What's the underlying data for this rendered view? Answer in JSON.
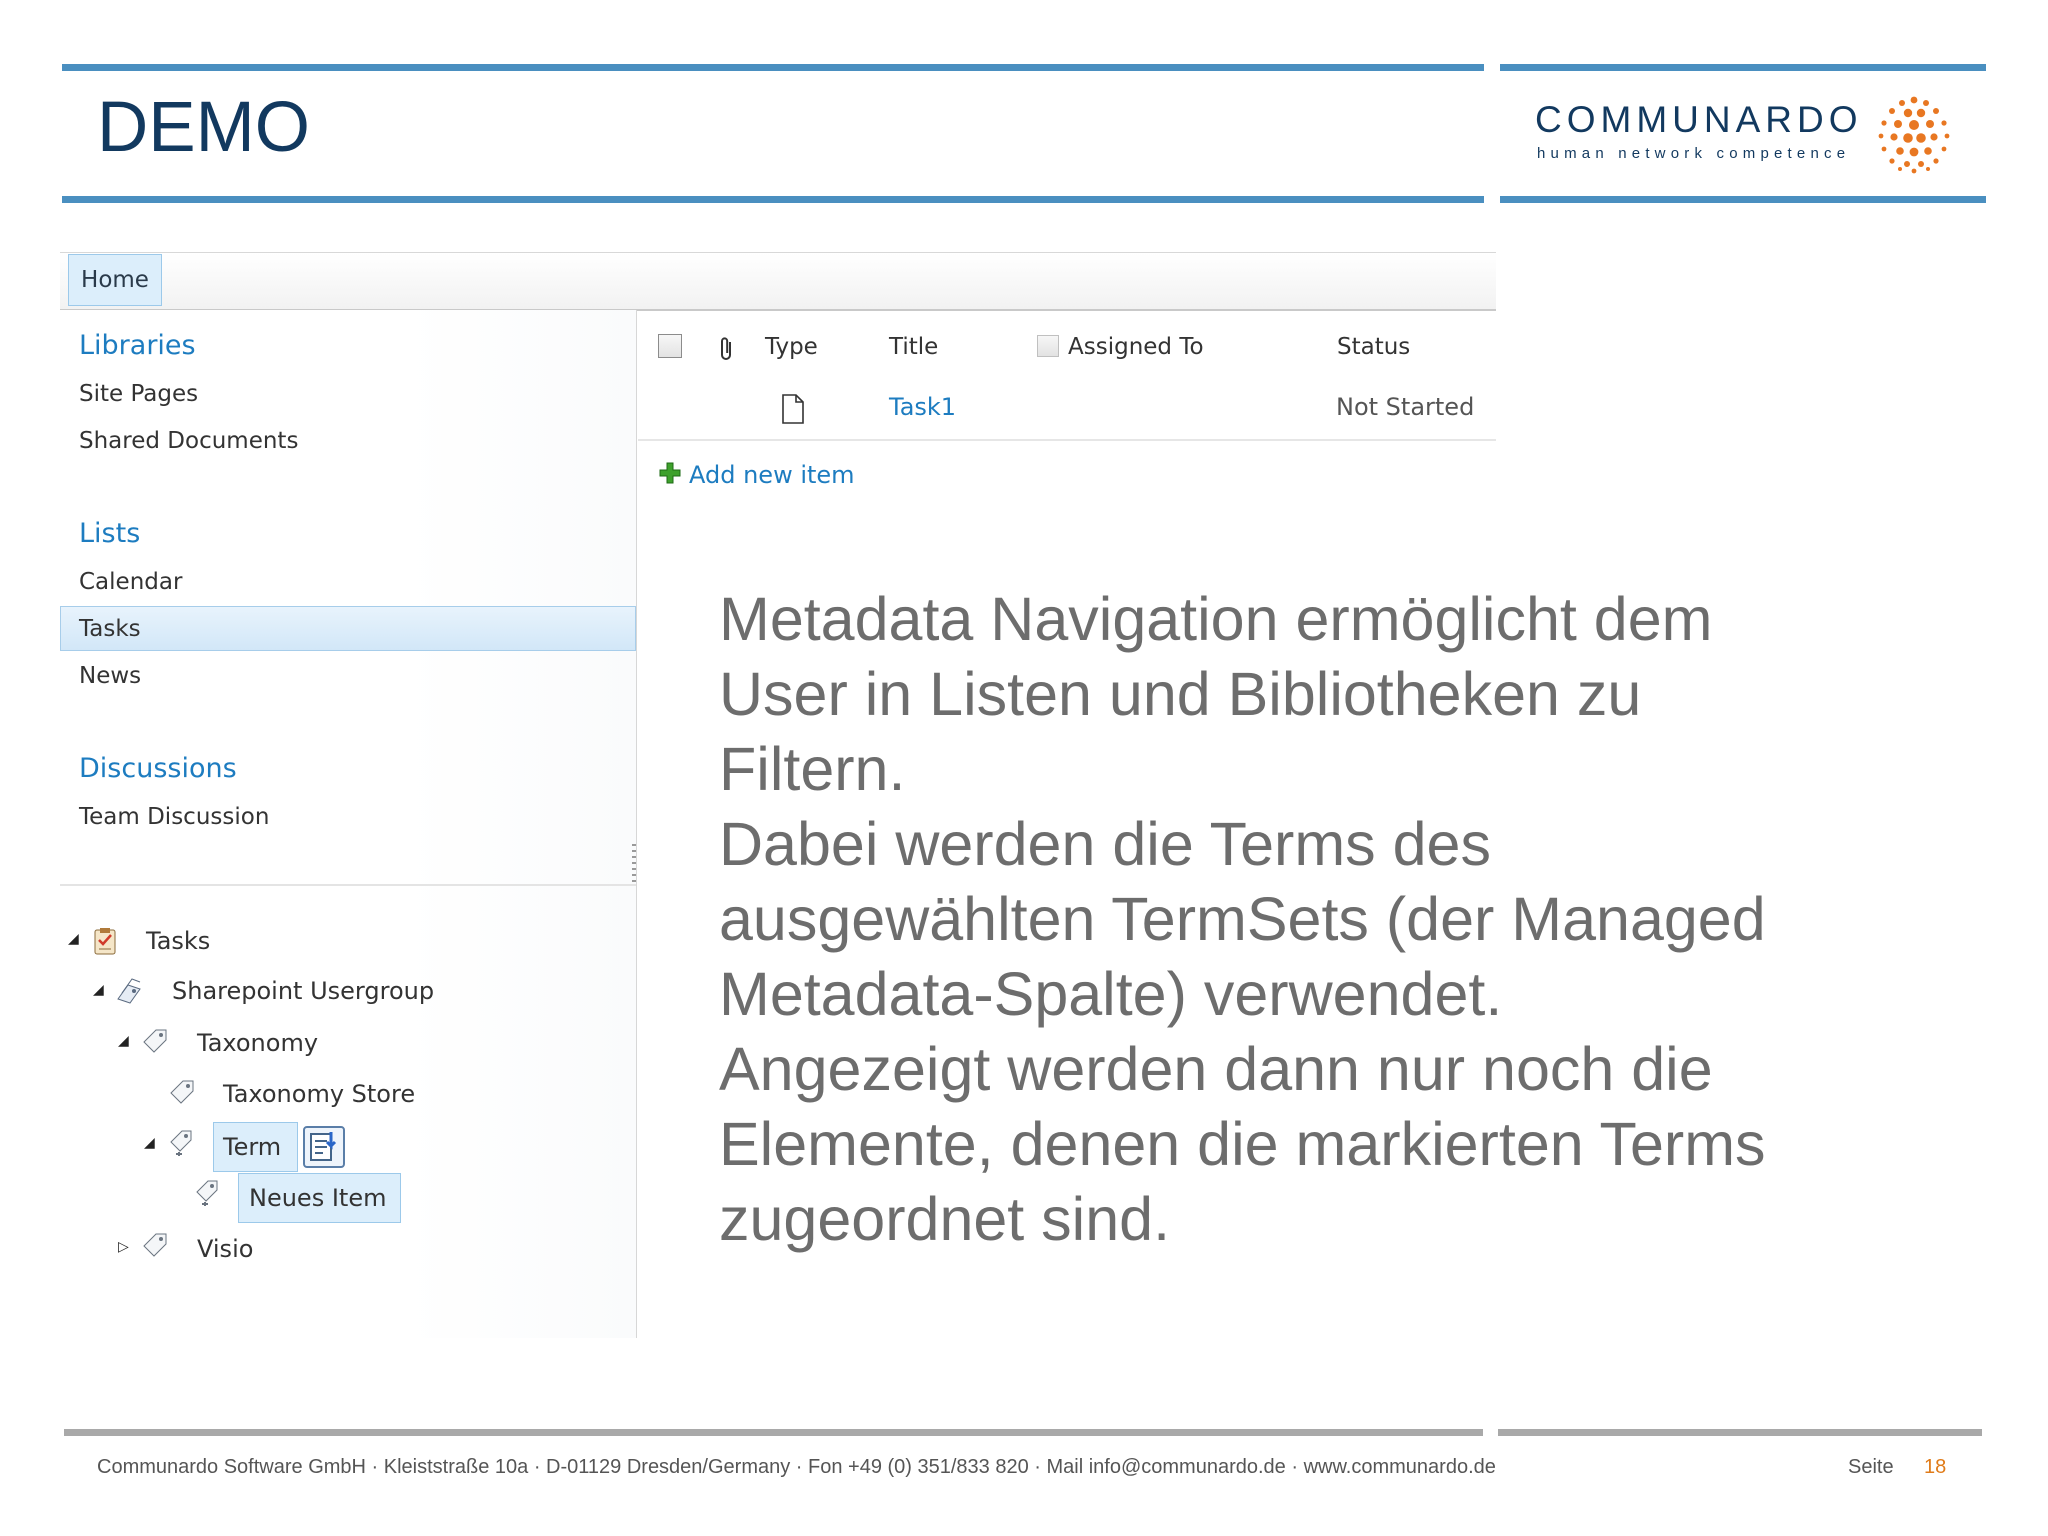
{
  "slide": {
    "title": "DEMO",
    "logo": {
      "word": "COMMUNARDO",
      "tagline": "human network competence",
      "dot_color": "#e87722"
    },
    "accent": "#4a8fc0",
    "body_lines": [
      "Metadata Navigation ermöglicht dem",
      "User in Listen und Bibliotheken zu",
      "Filtern.",
      "Dabei werden die Terms des",
      "ausgewählten TermSets (der Managed",
      "Metadata-Spalte) verwendet.",
      "Angezeigt werden dann nur noch die",
      "Elemente, denen die markierten Terms",
      "zugeordnet sind."
    ],
    "footer": {
      "company": "Communardo Software GmbH · Kleiststraße 10a · D-01129 Dresden/Germany  · Fon +49 (0) 351/833 820 · Mail info@communardo.de · www.communardo.de",
      "page_label": "Seite",
      "page_number": "18"
    }
  },
  "sharepoint": {
    "ribbon": {
      "home_tab": "Home"
    },
    "quicklaunch": {
      "libraries": {
        "heading": "Libraries",
        "items": [
          "Site Pages",
          "Shared Documents"
        ]
      },
      "lists": {
        "heading": "Lists",
        "items": [
          "Calendar",
          "Tasks",
          "News"
        ],
        "selected": "Tasks"
      },
      "discussions": {
        "heading": "Discussions",
        "items": [
          "Team Discussion"
        ]
      }
    },
    "tree": {
      "root": "Tasks",
      "group": "Sharepoint Usergroup",
      "termstore": "Taxonomy",
      "store": "Taxonomy Store",
      "term": "Term",
      "child": "Neues Item",
      "other": "Visio"
    },
    "list": {
      "columns": {
        "type": "Type",
        "title": "Title",
        "assigned_to": "Assigned To",
        "status": "Status"
      },
      "rows": [
        {
          "title": "Task1",
          "assigned_to": "",
          "status": "Not Started"
        }
      ],
      "add_new": "Add new item"
    }
  }
}
